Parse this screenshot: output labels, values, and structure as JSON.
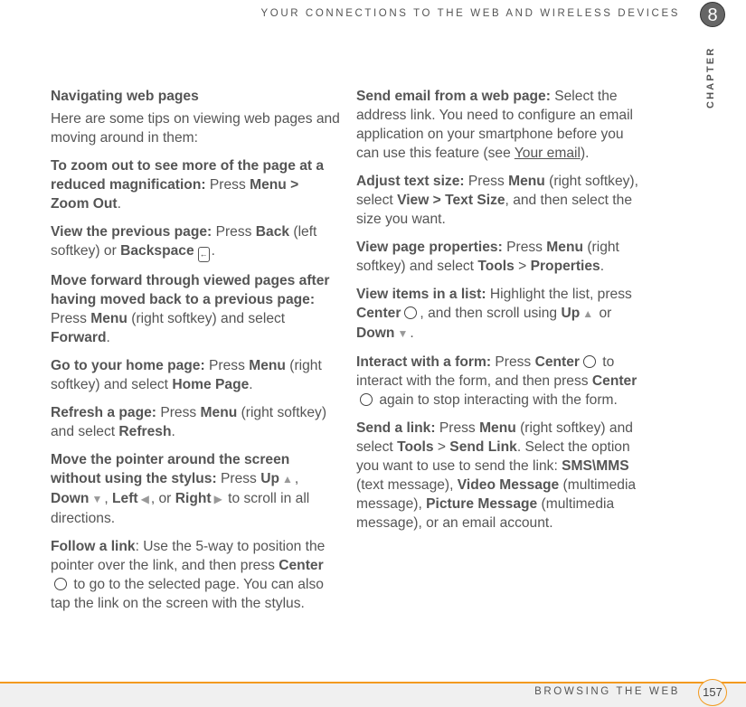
{
  "header": {
    "title": "YOUR CONNECTIONS TO THE WEB AND WIRELESS DEVICES",
    "chapter_number": "8",
    "chapter_label": "CHAPTER"
  },
  "footer": {
    "title": "BROWSING THE WEB",
    "page_number": "157",
    "accent_color": "#f39a1f"
  },
  "left": {
    "section_title": "Navigating web pages",
    "intro": "Here are some tips on viewing web pages and moving around in them:",
    "zoom": {
      "lead": "To zoom out to see more of the page at a reduced magnification:",
      "t1": " Press ",
      "b1": "Menu > Zoom Out",
      "t2": "."
    },
    "prev": {
      "lead": "View the previous page:",
      "t1": " Press ",
      "b1": "Back",
      "t2": " (left softkey) or ",
      "b2": "Backspace",
      "t3": "."
    },
    "forward": {
      "lead": "Move forward through viewed pages after having moved back to a previous page:",
      "t1": " Press ",
      "b1": "Menu",
      "t2": " (right softkey) and select ",
      "b2": "Forward",
      "t3": "."
    },
    "home": {
      "lead": "Go to your home page:",
      "t1": " Press ",
      "b1": "Menu",
      "t2": " (right softkey) and select ",
      "b2": "Home Page",
      "t3": "."
    },
    "refresh": {
      "lead": "Refresh a page:",
      "t1": " Press ",
      "b1": "Menu",
      "t2": " (right softkey) and select ",
      "b2": "Refresh",
      "t3": "."
    },
    "pointer": {
      "lead": "Move the pointer around the screen without using the stylus:",
      "t1": " Press ",
      "b1": "Up",
      "t2": ", ",
      "b2": "Down",
      "t3": ", ",
      "b3": "Left",
      "t4": ", or ",
      "b4": "Right",
      "t5": " to scroll in all directions."
    },
    "follow": {
      "lead": "Follow a link",
      "t1": ": Use the 5-way to position the pointer over the link, and then press ",
      "b1": "Center",
      "t2": " to go to the selected page. You can also tap the link on the screen with the stylus."
    }
  },
  "right": {
    "email": {
      "lead": "Send email from a web page:",
      "t1": " Select the address link. You need to configure an email application on your smartphone before you can use this feature (see ",
      "link": "Your email",
      "t2": ")."
    },
    "textsize": {
      "lead": "Adjust text size:",
      "t1": " Press ",
      "b1": "Menu",
      "t2": " (right softkey), select ",
      "b2": "View > Text Size",
      "t3": ", and then select the size you want."
    },
    "props": {
      "lead": "View page properties:",
      "t1": " Press ",
      "b1": "Menu",
      "t2": " (right softkey) and select ",
      "b2": "Tools",
      "t3": " > ",
      "b3": "Properties",
      "t4": "."
    },
    "list": {
      "lead": "View items in a list:",
      "t1": " Highlight the list, press ",
      "b1": "Center",
      "t2": ", and then scroll using ",
      "b2": "Up",
      "t3": " or ",
      "b3": "Down",
      "t4": "."
    },
    "form": {
      "lead": "Interact with a form:",
      "t1": " Press ",
      "b1": "Center",
      "t2": " to interact with the form, and then press ",
      "b2": "Center",
      "t3": " again to stop interacting with the form."
    },
    "sendlink": {
      "lead": "Send a link:",
      "t1": " Press ",
      "b1": "Menu",
      "t2": " (right softkey) and select ",
      "b2": "Tools",
      "t3": " > ",
      "b3": "Send Link",
      "t4": ". Select the option you want to use to send the link: ",
      "b4": "SMS\\MMS",
      "t5": " (text message), ",
      "b5": "Video Message",
      "t6": " (multimedia message), ",
      "b6": "Picture Message",
      "t7": " (multimedia message), or an email account."
    }
  },
  "icons": {
    "backspace": "backspace-key-icon",
    "center": "center-button-icon",
    "up": "up-arrow-icon",
    "down": "down-arrow-icon",
    "left": "left-arrow-icon",
    "right": "right-arrow-icon"
  }
}
